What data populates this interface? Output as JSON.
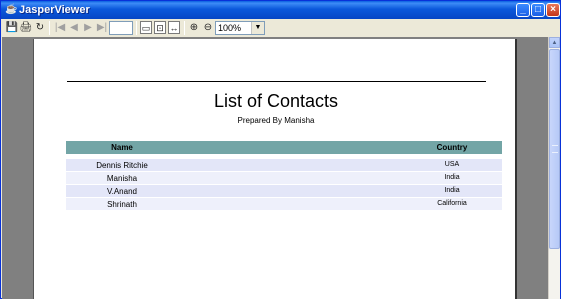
{
  "window": {
    "title": "JasperViewer",
    "icon": "app-icon",
    "controls": {
      "minimize": "_",
      "maximize": "□",
      "close": "×"
    }
  },
  "toolbar": {
    "save_icon": "save-icon",
    "print_icon": "print-icon",
    "reload_icon": "reload-icon",
    "first_icon": "first-page-icon",
    "prev_icon": "previous-page-icon",
    "next_icon": "next-page-icon",
    "last_icon": "last-page-icon",
    "page_value": "",
    "actual_size_icon": "actual-size-icon",
    "fit_page_icon": "fit-page-icon",
    "fit_width_icon": "fit-width-icon",
    "zoom_in_icon": "zoom-in-icon",
    "zoom_out_icon": "zoom-out-icon",
    "zoom_value": "100%"
  },
  "report": {
    "title": "List of Contacts",
    "subtitle": "Prepared By Manisha",
    "columns": [
      "Name",
      "Country"
    ],
    "rows": [
      {
        "name": "Dennis Ritchie",
        "country": "USA"
      },
      {
        "name": "Manisha",
        "country": "India"
      },
      {
        "name": "V.Anand",
        "country": "India"
      },
      {
        "name": "Shrinath",
        "country": "California"
      }
    ]
  },
  "colors": {
    "header_bg": "#73a5a6",
    "row_bg": "#e3e6f8",
    "titlebar": "#0b58db"
  }
}
